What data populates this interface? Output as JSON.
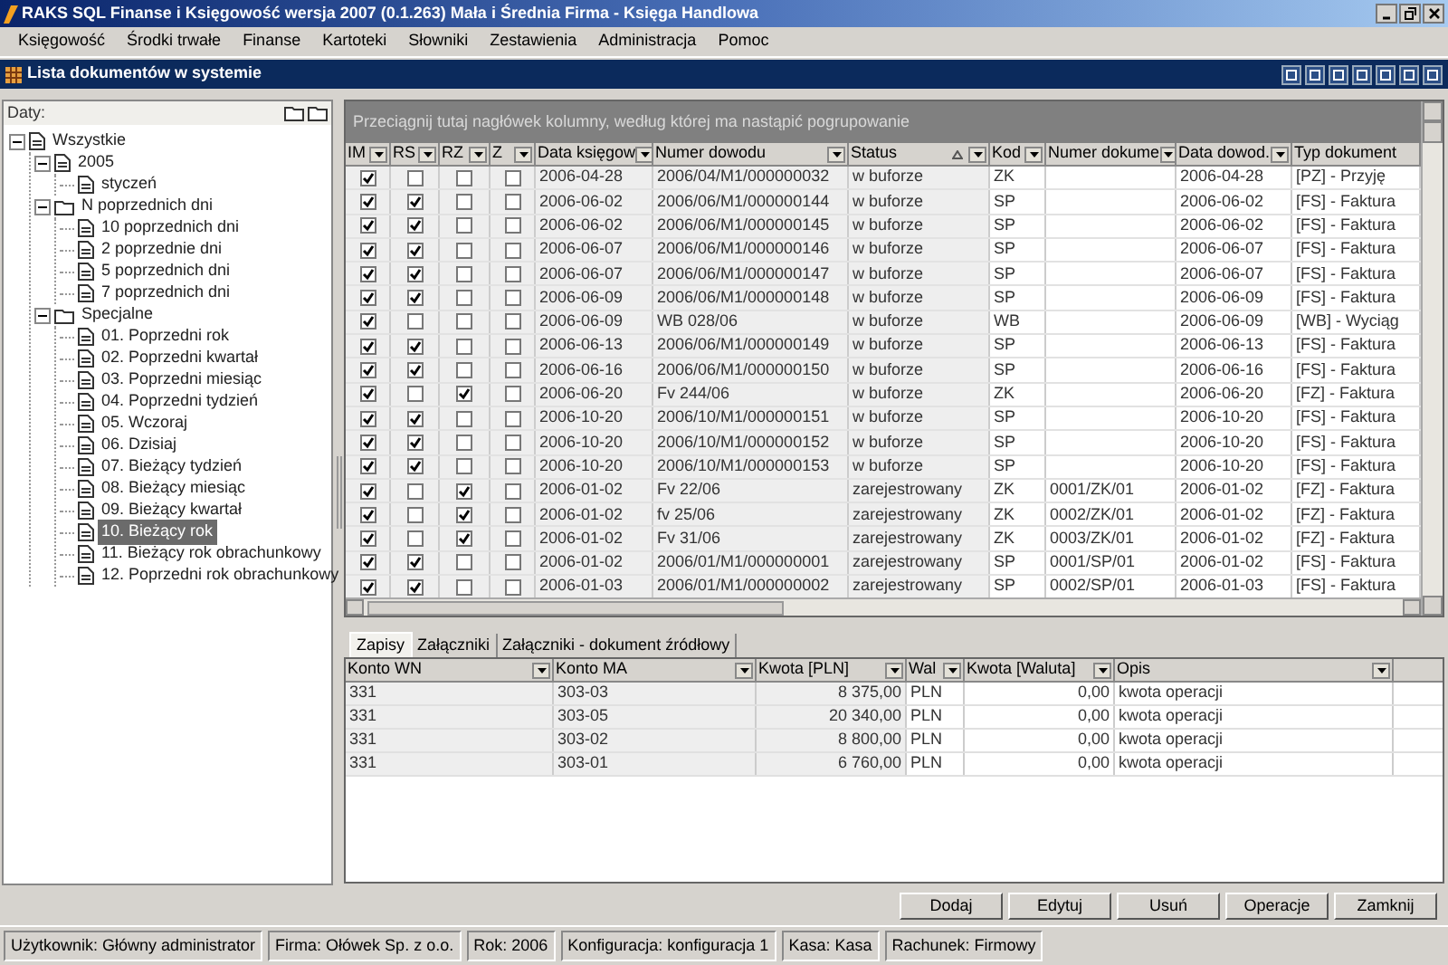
{
  "window": {
    "title": "RAKS SQL Finanse i Księgowość wersja 2007 (0.1.263) Mała i Średnia Firma - Księga Handlowa"
  },
  "menu": [
    {
      "label": "Księgowość"
    },
    {
      "label": "Środki trwałe"
    },
    {
      "label": "Finanse"
    },
    {
      "label": "Kartoteki"
    },
    {
      "label": "Słowniki"
    },
    {
      "label": "Zestawienia"
    },
    {
      "label": "Administracja"
    },
    {
      "label": "Pomoc"
    }
  ],
  "panel_title": "Lista dokumentów w systemie",
  "tree": {
    "label": "Daty:",
    "items": [
      {
        "label": "Wszystkie",
        "kind": "page",
        "expanded": true,
        "selected": false,
        "children": [
          {
            "label": "2005",
            "kind": "page",
            "expanded": true,
            "selected": false,
            "children": [
              {
                "label": "styczeń",
                "kind": "page",
                "selected": false
              }
            ]
          },
          {
            "label": "N poprzednich dni",
            "kind": "folder",
            "expanded": true,
            "selected": false,
            "children": [
              {
                "label": "10 poprzednich dni",
                "kind": "page",
                "selected": false
              },
              {
                "label": "2 poprzednie dni",
                "kind": "page",
                "selected": false
              },
              {
                "label": "5 poprzednich dni",
                "kind": "page",
                "selected": false
              },
              {
                "label": "7 poprzednich dni",
                "kind": "page",
                "selected": false
              }
            ]
          },
          {
            "label": "Specjalne",
            "kind": "folder",
            "expanded": true,
            "selected": false,
            "children": [
              {
                "label": "01. Poprzedni rok",
                "kind": "page",
                "selected": false
              },
              {
                "label": "02. Poprzedni kwartał",
                "kind": "page",
                "selected": false
              },
              {
                "label": "03. Poprzedni miesiąc",
                "kind": "page",
                "selected": false
              },
              {
                "label": "04. Poprzedni tydzień",
                "kind": "page",
                "selected": false
              },
              {
                "label": "05. Wczoraj",
                "kind": "page",
                "selected": false
              },
              {
                "label": "06. Dzisiaj",
                "kind": "page",
                "selected": false
              },
              {
                "label": "07. Bieżący tydzień",
                "kind": "page",
                "selected": false
              },
              {
                "label": "08. Bieżący miesiąc",
                "kind": "page",
                "selected": false
              },
              {
                "label": "09. Bieżący kwartał",
                "kind": "page",
                "selected": false
              },
              {
                "label": "10. Bieżący rok",
                "kind": "page",
                "selected": true
              },
              {
                "label": "11. Bieżący rok obrachunkowy",
                "kind": "page",
                "selected": false
              },
              {
                "label": "12. Poprzedni rok obrachunkowy",
                "kind": "page",
                "selected": false
              }
            ]
          }
        ]
      }
    ]
  },
  "grid": {
    "group_hint": "Przeciągnij tutaj nagłówek kolumny, według której ma nastąpić pogrupowanie",
    "columns": [
      {
        "label": "IM",
        "kind": "check",
        "sorted": false
      },
      {
        "label": "RS",
        "kind": "check",
        "sorted": false
      },
      {
        "label": "RZ",
        "kind": "check",
        "sorted": false
      },
      {
        "label": "Z",
        "kind": "check",
        "sorted": false
      },
      {
        "label": "Data księgow",
        "kind": "text",
        "sorted": false
      },
      {
        "label": "Numer dowodu",
        "kind": "text",
        "sorted": false
      },
      {
        "label": "Status",
        "kind": "text",
        "sorted": true
      },
      {
        "label": "Kod",
        "kind": "text",
        "sorted": false
      },
      {
        "label": "Numer dokume",
        "kind": "text",
        "sorted": false
      },
      {
        "label": "Data dowod.",
        "kind": "text",
        "sorted": false
      },
      {
        "label": "Typ dokument",
        "kind": "text",
        "sorted": false
      }
    ],
    "rows": [
      {
        "cells": [
          {
            "checked": true
          },
          {
            "checked": false
          },
          {
            "checked": false
          },
          {
            "checked": false
          },
          "2006-04-28",
          "2006/04/M1/000000032",
          "w buforze",
          "ZK",
          "",
          "2006-04-28",
          "[PZ] - Przyję"
        ]
      },
      {
        "cells": [
          {
            "checked": true
          },
          {
            "checked": true
          },
          {
            "checked": false
          },
          {
            "checked": false
          },
          "2006-06-02",
          "2006/06/M1/000000144",
          "w buforze",
          "SP",
          "",
          "2006-06-02",
          "[FS] - Faktura"
        ]
      },
      {
        "cells": [
          {
            "checked": true
          },
          {
            "checked": true
          },
          {
            "checked": false
          },
          {
            "checked": false
          },
          "2006-06-02",
          "2006/06/M1/000000145",
          "w buforze",
          "SP",
          "",
          "2006-06-02",
          "[FS] - Faktura"
        ]
      },
      {
        "cells": [
          {
            "checked": true
          },
          {
            "checked": true
          },
          {
            "checked": false
          },
          {
            "checked": false
          },
          "2006-06-07",
          "2006/06/M1/000000146",
          "w buforze",
          "SP",
          "",
          "2006-06-07",
          "[FS] - Faktura"
        ]
      },
      {
        "cells": [
          {
            "checked": true
          },
          {
            "checked": true
          },
          {
            "checked": false
          },
          {
            "checked": false
          },
          "2006-06-07",
          "2006/06/M1/000000147",
          "w buforze",
          "SP",
          "",
          "2006-06-07",
          "[FS] - Faktura"
        ]
      },
      {
        "cells": [
          {
            "checked": true
          },
          {
            "checked": true
          },
          {
            "checked": false
          },
          {
            "checked": false
          },
          "2006-06-09",
          "2006/06/M1/000000148",
          "w buforze",
          "SP",
          "",
          "2006-06-09",
          "[FS] - Faktura"
        ]
      },
      {
        "cells": [
          {
            "checked": true
          },
          {
            "checked": false
          },
          {
            "checked": false
          },
          {
            "checked": false
          },
          "2006-06-09",
          "WB 028/06",
          "w buforze",
          "WB",
          "",
          "2006-06-09",
          "[WB] - Wyciąg"
        ]
      },
      {
        "cells": [
          {
            "checked": true
          },
          {
            "checked": true
          },
          {
            "checked": false
          },
          {
            "checked": false
          },
          "2006-06-13",
          "2006/06/M1/000000149",
          "w buforze",
          "SP",
          "",
          "2006-06-13",
          "[FS] - Faktura"
        ]
      },
      {
        "cells": [
          {
            "checked": true
          },
          {
            "checked": true
          },
          {
            "checked": false
          },
          {
            "checked": false
          },
          "2006-06-16",
          "2006/06/M1/000000150",
          "w buforze",
          "SP",
          "",
          "2006-06-16",
          "[FS] - Faktura"
        ]
      },
      {
        "cells": [
          {
            "checked": true
          },
          {
            "checked": false
          },
          {
            "checked": true
          },
          {
            "checked": false
          },
          "2006-06-20",
          "Fv 244/06",
          "w buforze",
          "ZK",
          "",
          "2006-06-20",
          "[FZ] - Faktura"
        ]
      },
      {
        "cells": [
          {
            "checked": true
          },
          {
            "checked": true
          },
          {
            "checked": false
          },
          {
            "checked": false
          },
          "2006-10-20",
          "2006/10/M1/000000151",
          "w buforze",
          "SP",
          "",
          "2006-10-20",
          "[FS] - Faktura"
        ]
      },
      {
        "cells": [
          {
            "checked": true
          },
          {
            "checked": true
          },
          {
            "checked": false
          },
          {
            "checked": false
          },
          "2006-10-20",
          "2006/10/M1/000000152",
          "w buforze",
          "SP",
          "",
          "2006-10-20",
          "[FS] - Faktura"
        ]
      },
      {
        "cells": [
          {
            "checked": true
          },
          {
            "checked": true
          },
          {
            "checked": false
          },
          {
            "checked": false
          },
          "2006-10-20",
          "2006/10/M1/000000153",
          "w buforze",
          "SP",
          "",
          "2006-10-20",
          "[FS] - Faktura"
        ]
      },
      {
        "cells": [
          {
            "checked": true
          },
          {
            "checked": false
          },
          {
            "checked": true
          },
          {
            "checked": false
          },
          "2006-01-02",
          "Fv 22/06",
          "zarejestrowany",
          "ZK",
          "0001/ZK/01",
          "2006-01-02",
          "[FZ] - Faktura"
        ]
      },
      {
        "cells": [
          {
            "checked": true
          },
          {
            "checked": false
          },
          {
            "checked": true
          },
          {
            "checked": false
          },
          "2006-01-02",
          "fv 25/06",
          "zarejestrowany",
          "ZK",
          "0002/ZK/01",
          "2006-01-02",
          "[FZ] - Faktura"
        ]
      },
      {
        "cells": [
          {
            "checked": true
          },
          {
            "checked": false
          },
          {
            "checked": true
          },
          {
            "checked": false
          },
          "2006-01-02",
          "Fv 31/06",
          "zarejestrowany",
          "ZK",
          "0003/ZK/01",
          "2006-01-02",
          "[FZ] - Faktura"
        ]
      },
      {
        "cells": [
          {
            "checked": true
          },
          {
            "checked": true
          },
          {
            "checked": false
          },
          {
            "checked": false
          },
          "2006-01-02",
          "2006/01/M1/000000001",
          "zarejestrowany",
          "SP",
          "0001/SP/01",
          "2006-01-02",
          "[FS] - Faktura"
        ]
      },
      {
        "cells": [
          {
            "checked": true
          },
          {
            "checked": true
          },
          {
            "checked": false
          },
          {
            "checked": false
          },
          "2006-01-03",
          "2006/01/M1/000000002",
          "zarejestrowany",
          "SP",
          "0002/SP/01",
          "2006-01-03",
          "[FS] - Faktura"
        ]
      }
    ]
  },
  "tabs": [
    {
      "label": "Zapisy",
      "selected": true
    },
    {
      "label": "Załączniki",
      "selected": false
    },
    {
      "label": "Załączniki - dokument źródłowy",
      "selected": false
    }
  ],
  "entries": {
    "columns": [
      "Konto WN",
      "Konto MA",
      "Kwota [PLN]",
      "Wal",
      "Kwota [Waluta]",
      "Opis"
    ],
    "rows": [
      [
        "331",
        "303-03",
        "8 375,00",
        "PLN",
        "0,00",
        "kwota operacji"
      ],
      [
        "331",
        "303-05",
        "20 340,00",
        "PLN",
        "0,00",
        "kwota operacji"
      ],
      [
        "331",
        "303-02",
        "8 800,00",
        "PLN",
        "0,00",
        "kwota operacji"
      ],
      [
        "331",
        "303-01",
        "6 760,00",
        "PLN",
        "0,00",
        "kwota operacji"
      ]
    ]
  },
  "buttons": [
    {
      "label": "Dodaj"
    },
    {
      "label": "Edytuj"
    },
    {
      "label": "Usuń"
    },
    {
      "label": "Operacje"
    },
    {
      "label": "Zamknij"
    }
  ],
  "status_bar": [
    "Użytkownik: Główny administrator",
    "Firma: Ołówek Sp. z o.o.",
    "Rok: 2006",
    "Konfiguracja: konfiguracja 1",
    "Kasa: Kasa",
    "Rachunek: Firmowy"
  ]
}
